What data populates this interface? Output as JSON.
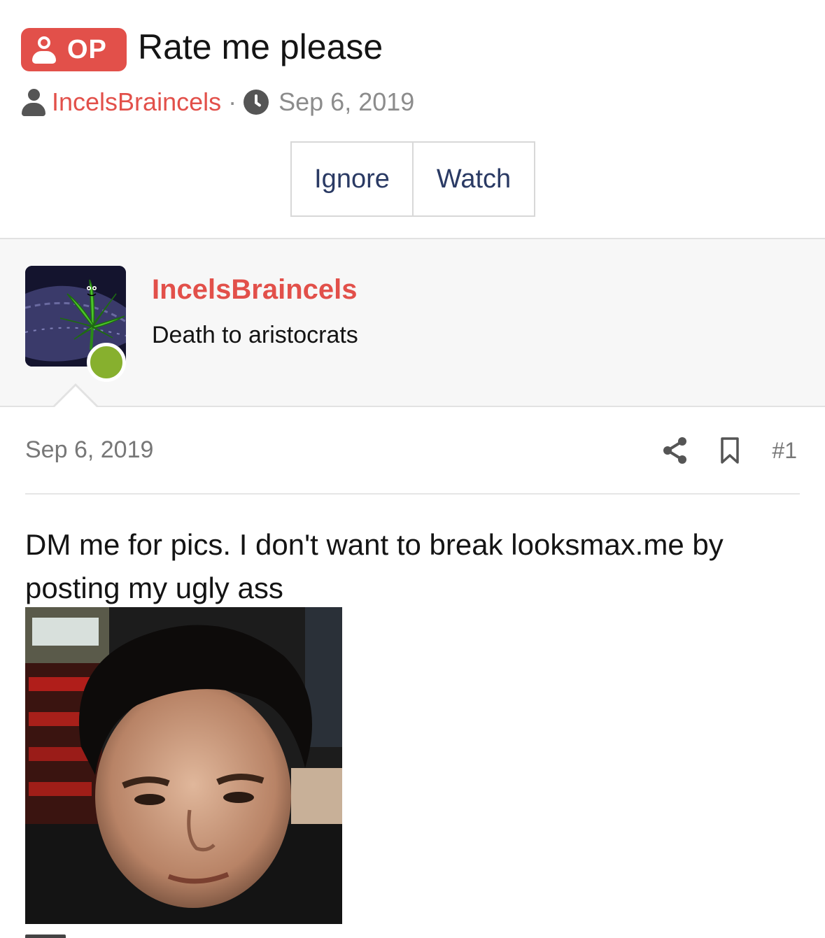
{
  "thread": {
    "badge": "OP",
    "title": "Rate me please",
    "author": "IncelsBraincels",
    "separator": "·",
    "date": "Sep 6, 2019",
    "buttons": {
      "ignore": "Ignore",
      "watch": "Watch"
    }
  },
  "user": {
    "name": "IncelsBraincels",
    "title": "Death to aristocrats",
    "status": "online"
  },
  "post": {
    "date": "Sep 6, 2019",
    "number": "#1",
    "body": "DM me for pics. I don't want to break looksmax.me by posting my ugly ass",
    "icons": [
      "share-icon",
      "bookmark-icon"
    ]
  },
  "colors": {
    "accent": "#e2504a",
    "button_text": "#2a3a64",
    "online": "#87b02e",
    "muted": "#777777"
  }
}
